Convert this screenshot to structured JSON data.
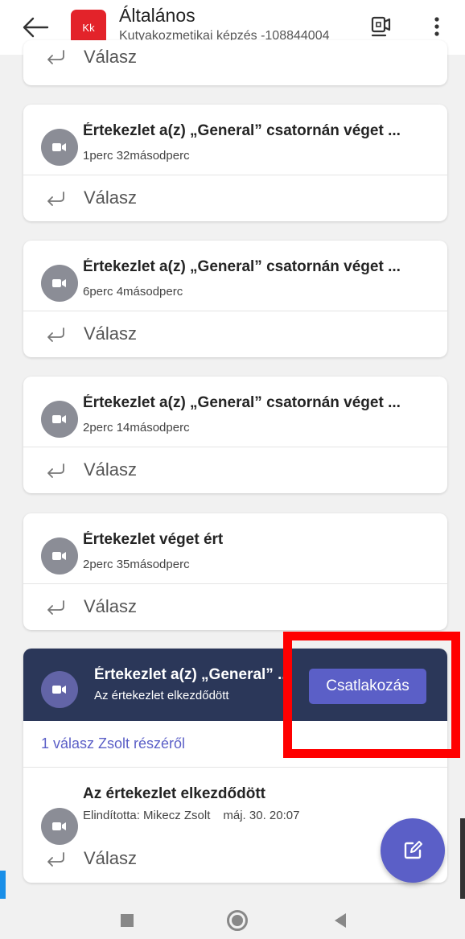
{
  "header": {
    "title": "Általános",
    "subtitle": "Kutyakozmetikai képzés -108844004",
    "team_initials": "Kk",
    "icons": {
      "back": "arrow-left-icon",
      "meet": "video-meet-icon",
      "more": "more-vertical-icon"
    }
  },
  "feed": {
    "top_partial_reply": "Válasz",
    "cards": [
      {
        "title": "Értekezlet a(z) „General” csatornán  véget ...",
        "subtitle": "1perc 32másodperc",
        "reply": "Válasz"
      },
      {
        "title": "Értekezlet a(z) „General” csatornán  véget ...",
        "subtitle": "6perc 4másodperc",
        "reply": "Válasz"
      },
      {
        "title": "Értekezlet a(z) „General” csatornán  véget ...",
        "subtitle": "2perc 14másodperc",
        "reply": "Válasz"
      },
      {
        "title": "Értekezlet véget ért",
        "subtitle": "2perc 35másodperc",
        "reply": "Válasz"
      }
    ],
    "live_meeting": {
      "title": "Értekezlet a(z) „General” ...",
      "subtitle": "Az értekezlet elkezdődött",
      "join_label": "Csatlakozás",
      "replies_link": "1 válasz Zsolt részéről",
      "message_title": "Az értekezlet elkezdődött",
      "message_author": "Elindította: Mikecz Zsolt",
      "message_time": "máj. 30. 20:07",
      "reply": "Válasz"
    }
  },
  "colors": {
    "accent": "#5b5fc7",
    "banner": "#2b3759",
    "team_avatar": "#e3232a",
    "highlight": "#ff0000"
  }
}
